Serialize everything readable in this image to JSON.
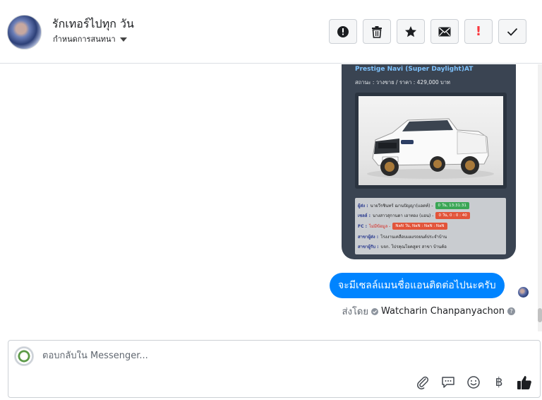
{
  "header": {
    "conversation_name": "รักเทอร์ไปทุก วัน",
    "conversation_sub": "กำหนดการสนทนา",
    "toolbar": {
      "spam_icon": "alert-circle-icon",
      "delete_icon": "trash-icon",
      "star_icon": "star-icon",
      "unread_icon": "envelope-icon",
      "important_glyph": "!",
      "done_icon": "check-icon"
    }
  },
  "thread": {
    "card": {
      "title": "Prestige Navi (Super Daylight)AT",
      "status": "สถานะ : วางขาย / ราคา : 429,000 บาท",
      "rows": [
        {
          "label": "ผู้ส่ง :",
          "value": "นายวีรชินทร์ ฌานปัญญา(แอดท์) -",
          "badge": "0 วัน, 13:31:31",
          "badge_color": "green"
        },
        {
          "label": "เซลล์ :",
          "value": "นางสาวสุกานดา เอาทอง (แอน) -",
          "badge": "0 วัน, 0 : 0 : 40",
          "badge_color": "red"
        },
        {
          "label": "FC :",
          "value": "ไม่มีข้อมูล -",
          "badge": "NaN วัน, NaN : NaN : NaN",
          "badge_color": "red"
        },
        {
          "label": "สาขาผู้ส่ง :",
          "value": "โรงงานเคลือบแผงรถยนต์ประจำบ้าน",
          "badge": "",
          "badge_color": ""
        },
        {
          "label": "สาขาผู้รับ :",
          "value": "บจก. โปรคุณโยคสูตร สาขา บ้านค้อ",
          "badge": "",
          "badge_color": ""
        }
      ]
    },
    "message": "จะมีเซลล์แมนชื่อแอนติดต่อไปนะครับ",
    "sent_by_label": "ส่งโดย",
    "sent_by_name": "Watcharin Chanpanyachon",
    "help_glyph": "?"
  },
  "composer": {
    "placeholder": "ตอบกลับใน Messenger...",
    "value": "",
    "currency_glyph": "฿",
    "icons": [
      "paperclip-icon",
      "chat-bubble-icon",
      "smiley-icon",
      "baht-icon",
      "thumbs-up-icon"
    ]
  },
  "colors": {
    "accent": "#0084ff",
    "card_bg": "#3a4452",
    "badge_green": "#3aa655",
    "badge_red": "#e2543a",
    "important": "#fa383e"
  }
}
